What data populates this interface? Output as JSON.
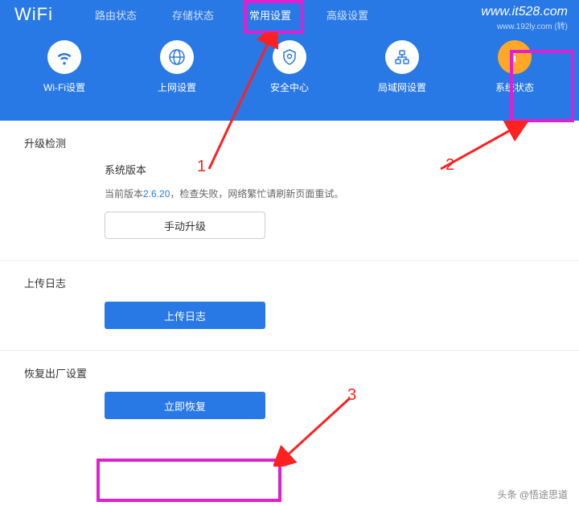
{
  "logo": "WiFi",
  "watermark": "www.it528.com",
  "watermark_sub": "www.192ly.com (转)",
  "nav": {
    "tabs": [
      {
        "label": "路由状态"
      },
      {
        "label": "存储状态"
      },
      {
        "label": "常用设置"
      },
      {
        "label": "高级设置"
      }
    ]
  },
  "icons": [
    {
      "label": "Wi-Fi设置",
      "name": "wifi-icon"
    },
    {
      "label": "上网设置",
      "name": "globe-icon"
    },
    {
      "label": "安全中心",
      "name": "shield-icon"
    },
    {
      "label": "局域网设置",
      "name": "lan-icon"
    },
    {
      "label": "系统状态",
      "name": "info-icon"
    }
  ],
  "sections": {
    "upgrade": {
      "title": "升级检测",
      "version_label": "系统版本",
      "version_prefix": "当前版本",
      "version_num": "2.6.20",
      "version_suffix": "，检查失败，网络繁忙请刷新页面重试。",
      "manual_btn": "手动升级"
    },
    "log": {
      "title": "上传日志",
      "btn": "上传日志"
    },
    "reset": {
      "title": "恢复出厂设置",
      "btn": "立即恢复"
    }
  },
  "annotations": {
    "n1": "1",
    "n2": "2",
    "n3": "3"
  },
  "credit": "头条 @悟途思道"
}
